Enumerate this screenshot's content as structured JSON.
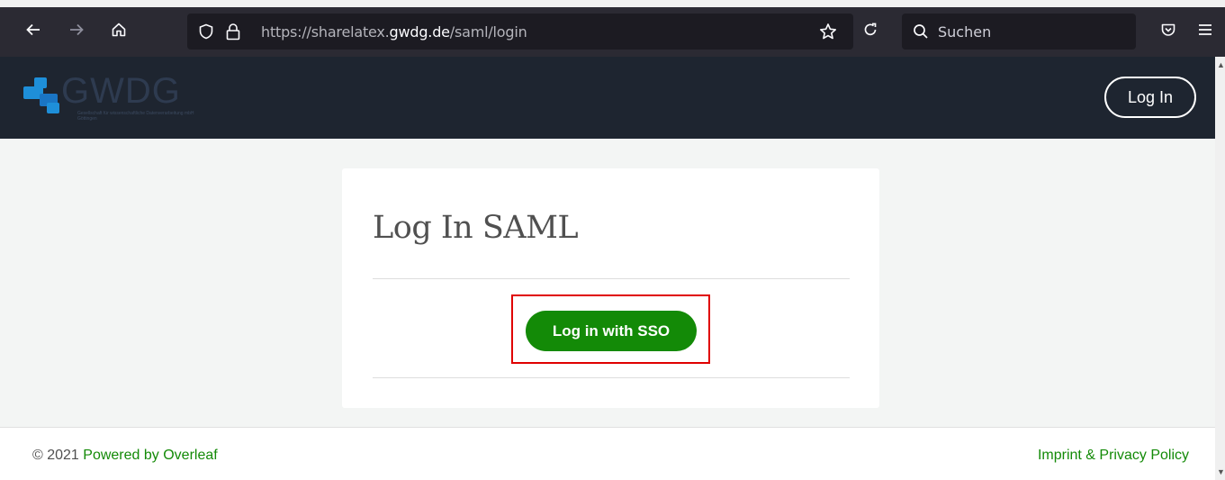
{
  "browser": {
    "url_prefix": "https://sharelatex.",
    "url_host": "gwdg.de",
    "url_path": "/saml/login",
    "search_placeholder": "Suchen"
  },
  "header": {
    "logo_text": "GWDG",
    "logo_subtitle": "Gesellschaft für wissenschaftliche Datenverarbeitung mbH Göttingen",
    "login_label": "Log In"
  },
  "card": {
    "title": "Log In SAML",
    "sso_label": "Log in with SSO"
  },
  "footer": {
    "copyright": "© 2021",
    "powered_by": "Powered by Overleaf",
    "imprint": "Imprint & Privacy Policy"
  },
  "colors": {
    "accent": "#138a07",
    "header_bg": "#1e2530",
    "highlight": "#e00000"
  }
}
